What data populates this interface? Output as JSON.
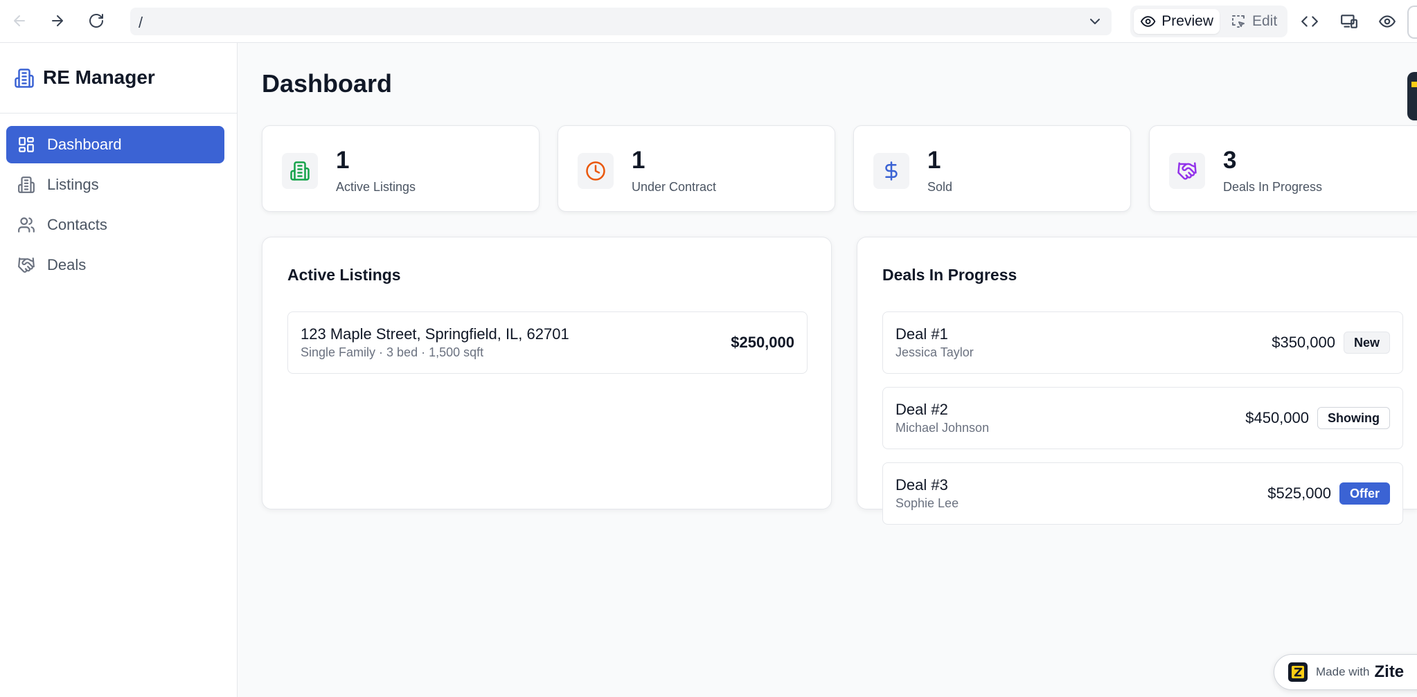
{
  "browser": {
    "url": "/",
    "modes": {
      "preview": "Preview",
      "edit": "Edit"
    }
  },
  "sidebar": {
    "brand": "RE Manager",
    "items": [
      {
        "label": "Dashboard",
        "icon": "dashboard-icon",
        "active": true
      },
      {
        "label": "Listings",
        "icon": "building-icon",
        "active": false
      },
      {
        "label": "Contacts",
        "icon": "users-icon",
        "active": false
      },
      {
        "label": "Deals",
        "icon": "handshake-icon",
        "active": false
      }
    ]
  },
  "main": {
    "title": "Dashboard",
    "stats": [
      {
        "value": "1",
        "label": "Active Listings",
        "icon": "building-icon",
        "color": "#16a34a"
      },
      {
        "value": "1",
        "label": "Under Contract",
        "icon": "clock-icon",
        "color": "#ea580c"
      },
      {
        "value": "1",
        "label": "Sold",
        "icon": "dollar-icon",
        "color": "#3b63d4"
      },
      {
        "value": "3",
        "label": "Deals In Progress",
        "icon": "handshake-icon",
        "color": "#9333ea"
      }
    ],
    "active_listings": {
      "title": "Active Listings",
      "items": [
        {
          "address": "123 Maple Street, Springfield, IL, 62701",
          "details": "Single Family · 3 bed · 1,500 sqft",
          "price": "$250,000"
        }
      ]
    },
    "deals": {
      "title": "Deals In Progress",
      "items": [
        {
          "name": "Deal #1",
          "contact": "Jessica Taylor",
          "amount": "$350,000",
          "stage": "New"
        },
        {
          "name": "Deal #2",
          "contact": "Michael Johnson",
          "amount": "$450,000",
          "stage": "Showing"
        },
        {
          "name": "Deal #3",
          "contact": "Sophie Lee",
          "amount": "$525,000",
          "stage": "Offer"
        }
      ]
    }
  },
  "footer": {
    "made_with": "Made with",
    "brand": "Zite"
  },
  "colors": {
    "primary": "#3b63d4",
    "background": "#f9fafb"
  }
}
